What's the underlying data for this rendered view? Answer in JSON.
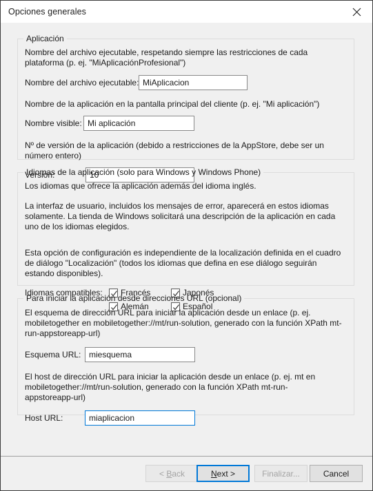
{
  "window": {
    "title": "Opciones generales",
    "close_icon": "close-icon"
  },
  "groups": {
    "application": {
      "legend": "Aplicación",
      "desc_exe": "Nombre del archivo ejecutable, respetando siempre las restricciones de cada plataforma (p. ej. \"MiAplicaciónProfesional\")",
      "label_exe": "Nombre del archivo ejecutable:",
      "value_exe": "MiAplicacion",
      "desc_visible": "Nombre de la aplicación en la pantalla principal del cliente (p. ej. \"Mi aplicación\")",
      "label_visible": "Nombre visible:",
      "value_visible": "Mi aplicación",
      "desc_version": "Nº de versión de la aplicación (debido a restricciones de la AppStore, debe ser un número entero)",
      "label_version": "Versión:",
      "value_version": "10"
    },
    "languages": {
      "legend": "Idiomas de la aplicación (solo para Windows y Windows Phone)",
      "desc_1": "Los idiomas que ofrece la aplicación además del idioma inglés.",
      "desc_2": "La interfaz de usuario, incluidos los mensajes de error, aparecerá en estos idiomas solamente. La tienda de Windows solicitará una descripción de la aplicación en cada uno de los idiomas elegidos.",
      "desc_3": "Esta opción de configuración es independiente de la localización definida en el cuadro de diálogo \"Localización\" (todos los idiomas que defina en ese diálogo seguirán estando disponibles).",
      "label_supported": "Idiomas compatibles:",
      "checkboxes": [
        {
          "label": "Francés",
          "checked": true
        },
        {
          "label": "Japonés",
          "checked": true
        },
        {
          "label": "Alemán",
          "checked": true
        },
        {
          "label": "Español",
          "checked": true
        }
      ]
    },
    "url": {
      "legend": "Para iniciar la aplicación desde direcciones URL (opcional)",
      "desc_scheme": "El esquema de dirección URL para iniciar la aplicación desde un enlace (p. ej. mobiletogether en mobiletogether://mt/run-solution, generado con la función XPath mt-run-appstoreapp-url)",
      "label_scheme": "Esquema URL:",
      "value_scheme": "miesquema",
      "desc_host": "El host de dirección URL para iniciar la aplicación desde un enlace (p. ej. mt en mobiletogether://mt/run-solution, generado con la función XPath mt-run-appstoreapp-url)",
      "label_host": "Host URL:",
      "value_host": "miaplicacion"
    }
  },
  "footer": {
    "back_label": "< Back",
    "back_accel": "B",
    "next_label": "Next >",
    "next_accel": "N",
    "finish_label": "Finalizar...",
    "cancel_label": "Cancel"
  },
  "colors": {
    "accent": "#0078d7",
    "dialog_bg": "#f0f0f0",
    "titlebar_bg": "#ffffff",
    "group_border": "#dcdcdc",
    "field_border": "#898989"
  }
}
